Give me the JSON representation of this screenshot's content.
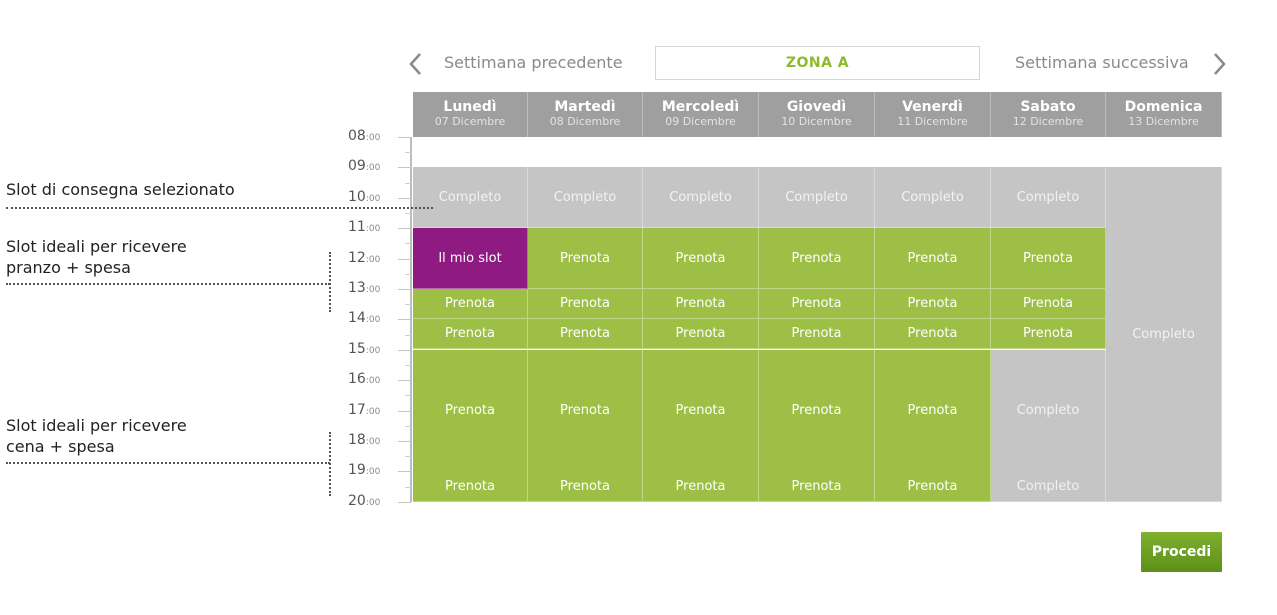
{
  "nav": {
    "prev_label": "Settimana precedente",
    "next_label": "Settimana successiva",
    "zone_label": "ZONA A",
    "prev_icon": "chevron-left-icon",
    "next_icon": "chevron-right-icon"
  },
  "days": [
    {
      "name": "Lunedì",
      "date": "07 Dicembre"
    },
    {
      "name": "Martedì",
      "date": "08 Dicembre"
    },
    {
      "name": "Mercoledì",
      "date": "09 Dicembre"
    },
    {
      "name": "Giovedì",
      "date": "10 Dicembre"
    },
    {
      "name": "Venerdì",
      "date": "11 Dicembre"
    },
    {
      "name": "Sabato",
      "date": "12 Dicembre"
    },
    {
      "name": "Domenica",
      "date": "13 Dicembre"
    }
  ],
  "hours": [
    {
      "h": "08",
      "m": ":00"
    },
    {
      "h": "09",
      "m": ":00"
    },
    {
      "h": "10",
      "m": ":00"
    },
    {
      "h": "11",
      "m": ":00"
    },
    {
      "h": "12",
      "m": ":00"
    },
    {
      "h": "13",
      "m": ":00"
    },
    {
      "h": "14",
      "m": ":00"
    },
    {
      "h": "15",
      "m": ":00"
    },
    {
      "h": "16",
      "m": ":00"
    },
    {
      "h": "17",
      "m": ":00"
    },
    {
      "h": "18",
      "m": ":00"
    },
    {
      "h": "19",
      "m": ":00"
    },
    {
      "h": "20",
      "m": ":00"
    }
  ],
  "slot_labels": {
    "full": "Completo",
    "book": "Prenota",
    "mine": "Il mio slot"
  },
  "schedule": [
    {
      "day": "Lunedì",
      "slots": [
        [
          "09:00",
          "11:00",
          "full"
        ],
        [
          "11:00",
          "13:00",
          "mine"
        ],
        [
          "13:00",
          "14:00",
          "book"
        ],
        [
          "14:00",
          "15:00",
          "book"
        ],
        [
          "15:00",
          "19:00",
          "book"
        ],
        [
          "19:00",
          "21:00",
          "book"
        ]
      ]
    },
    {
      "day": "Martedì",
      "slots": [
        [
          "09:00",
          "11:00",
          "full"
        ],
        [
          "11:00",
          "13:00",
          "book"
        ],
        [
          "13:00",
          "14:00",
          "book"
        ],
        [
          "14:00",
          "15:00",
          "book"
        ],
        [
          "15:00",
          "19:00",
          "book"
        ],
        [
          "19:00",
          "21:00",
          "book"
        ]
      ]
    },
    {
      "day": "Mercoledì",
      "slots": [
        [
          "09:00",
          "11:00",
          "full"
        ],
        [
          "11:00",
          "13:00",
          "book"
        ],
        [
          "13:00",
          "14:00",
          "book"
        ],
        [
          "14:00",
          "15:00",
          "book"
        ],
        [
          "15:00",
          "19:00",
          "book"
        ],
        [
          "19:00",
          "21:00",
          "book"
        ]
      ]
    },
    {
      "day": "Giovedì",
      "slots": [
        [
          "09:00",
          "11:00",
          "full"
        ],
        [
          "11:00",
          "13:00",
          "book"
        ],
        [
          "13:00",
          "14:00",
          "book"
        ],
        [
          "14:00",
          "15:00",
          "book"
        ],
        [
          "15:00",
          "19:00",
          "book"
        ],
        [
          "19:00",
          "21:00",
          "book"
        ]
      ]
    },
    {
      "day": "Venerdì",
      "slots": [
        [
          "09:00",
          "11:00",
          "full"
        ],
        [
          "11:00",
          "13:00",
          "book"
        ],
        [
          "13:00",
          "14:00",
          "book"
        ],
        [
          "14:00",
          "15:00",
          "book"
        ],
        [
          "15:00",
          "19:00",
          "book"
        ],
        [
          "19:00",
          "21:00",
          "book"
        ]
      ]
    },
    {
      "day": "Sabato",
      "slots": [
        [
          "09:00",
          "11:00",
          "full"
        ],
        [
          "11:00",
          "13:00",
          "book"
        ],
        [
          "13:00",
          "14:00",
          "book"
        ],
        [
          "14:00",
          "15:00",
          "book"
        ],
        [
          "15:00",
          "19:00",
          "full"
        ],
        [
          "19:00",
          "21:00",
          "full"
        ]
      ]
    },
    {
      "day": "Domenica",
      "slots": [
        [
          "09:00",
          "21:00",
          "full"
        ]
      ]
    }
  ],
  "annotations": {
    "selected": "Slot di consegna selezionato",
    "lunch_line1": "Slot ideali per ricevere",
    "lunch_line2": "pranzo + spesa",
    "dinner_line1": "Slot ideali per ricevere",
    "dinner_line2": "cena + spesa"
  },
  "colors": {
    "available": "#9ebf45",
    "full": "#c5c5c5",
    "selected": "#8f1a82",
    "header": "#9f9f9f",
    "zone_text": "#8dbb28",
    "button": "#6a9c22"
  },
  "procedi_label": "Procedi"
}
